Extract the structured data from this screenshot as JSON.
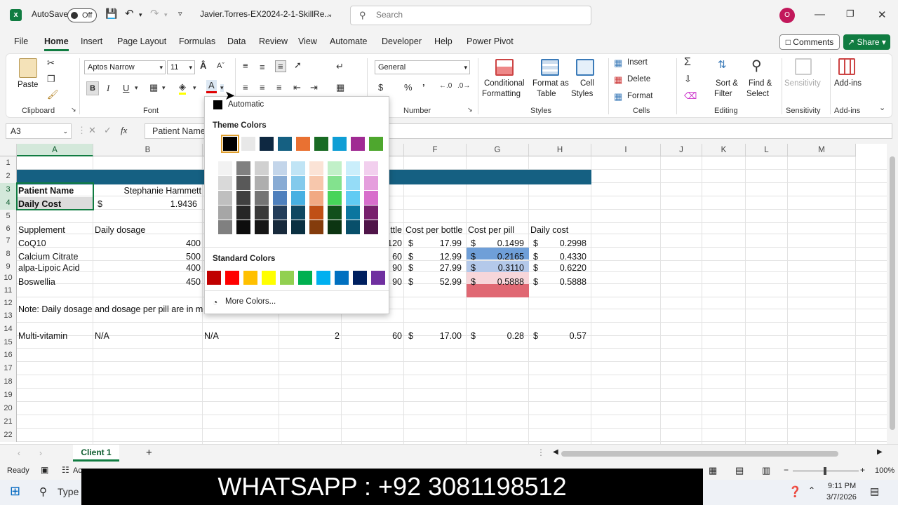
{
  "app": {
    "autosave_label": "AutoSave",
    "autosave_state": "Off",
    "filename": "Javier.Torres-EX2024-2-1-SkillRe...",
    "search_placeholder": "Search",
    "user_initial": "O"
  },
  "menu": [
    "File",
    "Home",
    "Insert",
    "Page Layout",
    "Formulas",
    "Data",
    "Review",
    "View",
    "Automate",
    "Developer",
    "Help",
    "Power Pivot"
  ],
  "menu_active": "Home",
  "comments_label": "Comments",
  "share_label": "Share",
  "ribbon": {
    "clipboard": {
      "paste": "Paste",
      "group": "Clipboard"
    },
    "font": {
      "name": "Aptos Narrow",
      "size": "11",
      "group": "Font",
      "bold": "B",
      "italic": "I",
      "underline": "U"
    },
    "number": {
      "format": "General",
      "group": "Number"
    },
    "styles": {
      "conditional": "Conditional",
      "conditional2": "Formatting",
      "format_as": "Format as",
      "format_as2": "Table",
      "cell": "Cell",
      "cell2": "Styles",
      "group": "Styles"
    },
    "cells": {
      "insert": "Insert",
      "delete": "Delete",
      "format": "Format",
      "group": "Cells"
    },
    "editing": {
      "sort": "Sort &",
      "sort2": "Filter",
      "find": "Find &",
      "find2": "Select",
      "group": "Editing"
    },
    "sensitivity": {
      "label": "Sensitivity",
      "group": "Sensitivity"
    },
    "addins": {
      "label": "Add-ins",
      "group": "Add-ins"
    }
  },
  "formula_bar": {
    "name_box": "A3",
    "fx": "fx",
    "content": "Patient Name"
  },
  "columns": [
    "A",
    "B",
    "C",
    "D",
    "E",
    "F",
    "G",
    "H",
    "I",
    "J",
    "K",
    "L",
    "M"
  ],
  "rows": [
    "1",
    "2",
    "3",
    "4",
    "5",
    "6",
    "7",
    "8",
    "9",
    "10",
    "11",
    "12",
    "13",
    "14",
    "15",
    "16",
    "17",
    "18",
    "19",
    "20",
    "21",
    "22"
  ],
  "cells": {
    "a3": "Patient Name",
    "b3": "Stephanie Hammett",
    "a4": "Daily Cost",
    "b4_cur": "$",
    "b4": "1.9436",
    "a6": "Supplement",
    "b6": "Daily dosage",
    "e6": "ttle",
    "f6": "Cost per bottle",
    "g6": "Cost per pill",
    "h6": "Daily cost",
    "a7": "CoQ10",
    "b7": "400",
    "e7": "120",
    "f7": "17.99",
    "g7": "0.1499",
    "h7": "0.2998",
    "a8": "Calcium Citrate",
    "b8": "500",
    "e8": "60",
    "f8": "12.99",
    "g8": "0.2165",
    "h8": "0.4330",
    "a9": "alpa-Lipoic Acid",
    "b9": "400",
    "e9": "90",
    "f9": "27.99",
    "g9": "0.3110",
    "h9": "0.6220",
    "a10": "Boswellia",
    "b10": "450",
    "e10": "90",
    "f10": "52.99",
    "g10": "0.5888",
    "h10": "0.5888",
    "a12": "Note: Daily dosage and dosage per pill are in m",
    "a14": "Multi-vitamin",
    "b14": "N/A",
    "c14": "N/A",
    "d14": "2",
    "e14": "60",
    "f14": "17.00",
    "g14": "0.28",
    "h14": "0.57",
    "cur": "$"
  },
  "picker": {
    "automatic": "Automatic",
    "theme_label": "Theme Colors",
    "standard_label": "Standard Colors",
    "more": "More Colors...",
    "theme_colors": [
      "#000000",
      "#e8e8e8",
      "#0e2841",
      "#156082",
      "#e97132",
      "#196b24",
      "#0f9ed5",
      "#a02b93",
      "#4ea72e"
    ],
    "standard_colors": [
      "#c00000",
      "#ff0000",
      "#ffc000",
      "#ffff00",
      "#92d050",
      "#00b050",
      "#00b0f0",
      "#0070c0",
      "#002060",
      "#7030a0"
    ]
  },
  "sheet_tab": "Client 1",
  "status": {
    "ready": "Ready",
    "accessibility": "Ac",
    "zoom": "100%"
  },
  "banner": "WHATSAPP :  +92 3081198512",
  "taskbar": {
    "type_placeholder": "Type",
    "time": "9:11 PM",
    "date": "3/7/2026"
  }
}
